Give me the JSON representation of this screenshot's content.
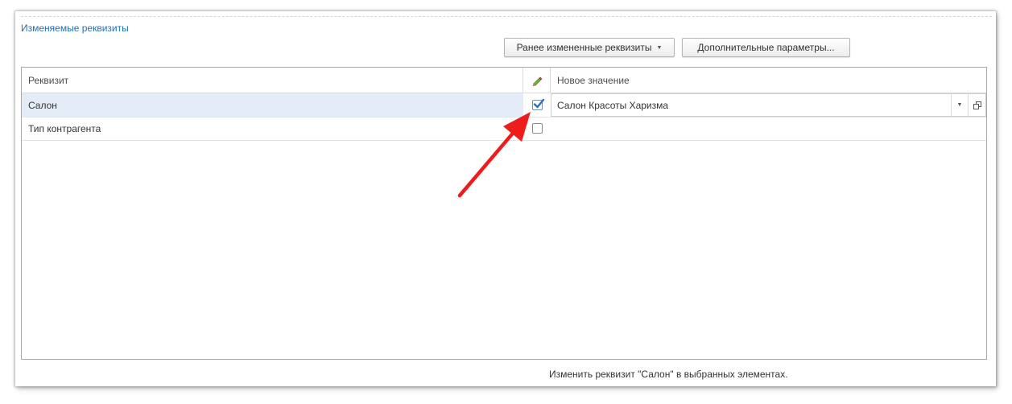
{
  "section": {
    "title": "Изменяемые реквизиты"
  },
  "toolbar": {
    "previous_label": "Ранее измененные реквизиты",
    "more_label": "Дополнительные параметры..."
  },
  "table": {
    "columns": {
      "name": "Реквизит",
      "flag_icon": "pencil-icon",
      "value": "Новое значение"
    },
    "rows": [
      {
        "name": "Салон",
        "checked": true,
        "value": "Салон Красоты Харизма"
      },
      {
        "name": "Тип контрагента",
        "checked": false,
        "value": ""
      }
    ]
  },
  "status": {
    "text": "Изменить реквизит \"Салон\" в выбранных элементах."
  },
  "colors": {
    "link": "#1f6fbd",
    "selected_row": "#e4edf7",
    "check": "#2c6fc4",
    "annotation_arrow": "#ee1c1c"
  }
}
